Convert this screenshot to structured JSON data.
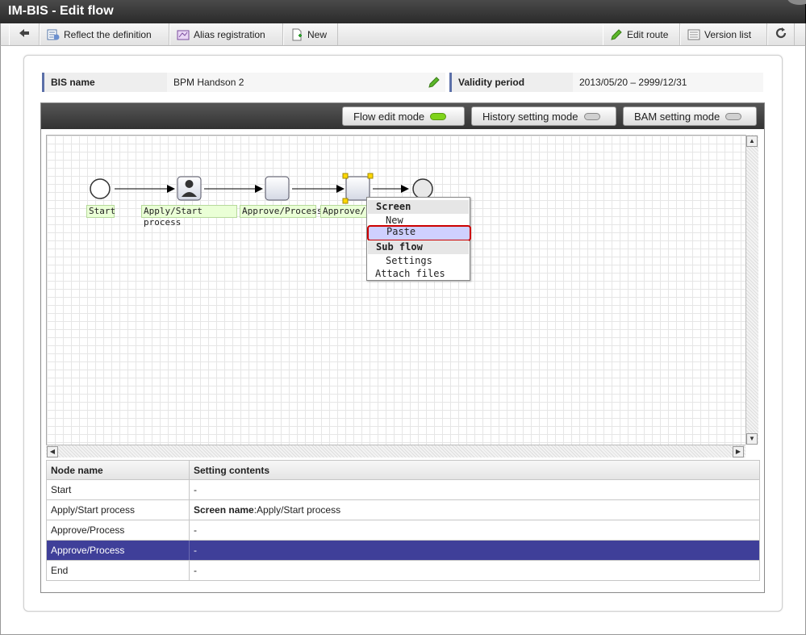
{
  "window": {
    "title": "IM-BIS - Edit flow"
  },
  "toolbar": {
    "reflect_label": "Reflect the definition",
    "alias_label": "Alias registration",
    "new_label": "New",
    "edit_route_label": "Edit route",
    "version_list_label": "Version list"
  },
  "info": {
    "bis_name_label": "BIS name",
    "bis_name_value": "BPM Handson 2",
    "validity_label": "Validity period",
    "validity_value": "2013/05/20 – 2999/12/31"
  },
  "modes": {
    "flow_edit": "Flow edit mode",
    "history_setting": "History setting mode",
    "bam_setting": "BAM setting mode",
    "active_led_color": "#7fd41a",
    "inactive_led_color": "#d0d0d0"
  },
  "flow": {
    "nodes": [
      "Start",
      "Apply/Start process",
      "Approve/Process",
      "Approve/P"
    ]
  },
  "context_menu": {
    "screen_header": "Screen",
    "screen_new": "New",
    "screen_paste": "Paste",
    "subflow_header": "Sub flow",
    "subflow_settings": "Settings",
    "attach_files": "Attach files"
  },
  "table": {
    "headers": [
      "Node name",
      "Setting contents"
    ],
    "rows": [
      {
        "name": "Start",
        "bold": "",
        "content": "-"
      },
      {
        "name": "Apply/Start process",
        "bold": "Screen name",
        "content": ":Apply/Start process"
      },
      {
        "name": "Approve/Process",
        "bold": "",
        "content": "-"
      },
      {
        "name": "Approve/Process",
        "bold": "",
        "content": "-"
      },
      {
        "name": "End",
        "bold": "",
        "content": "-"
      }
    ],
    "selected_color": "#3f3f99"
  }
}
